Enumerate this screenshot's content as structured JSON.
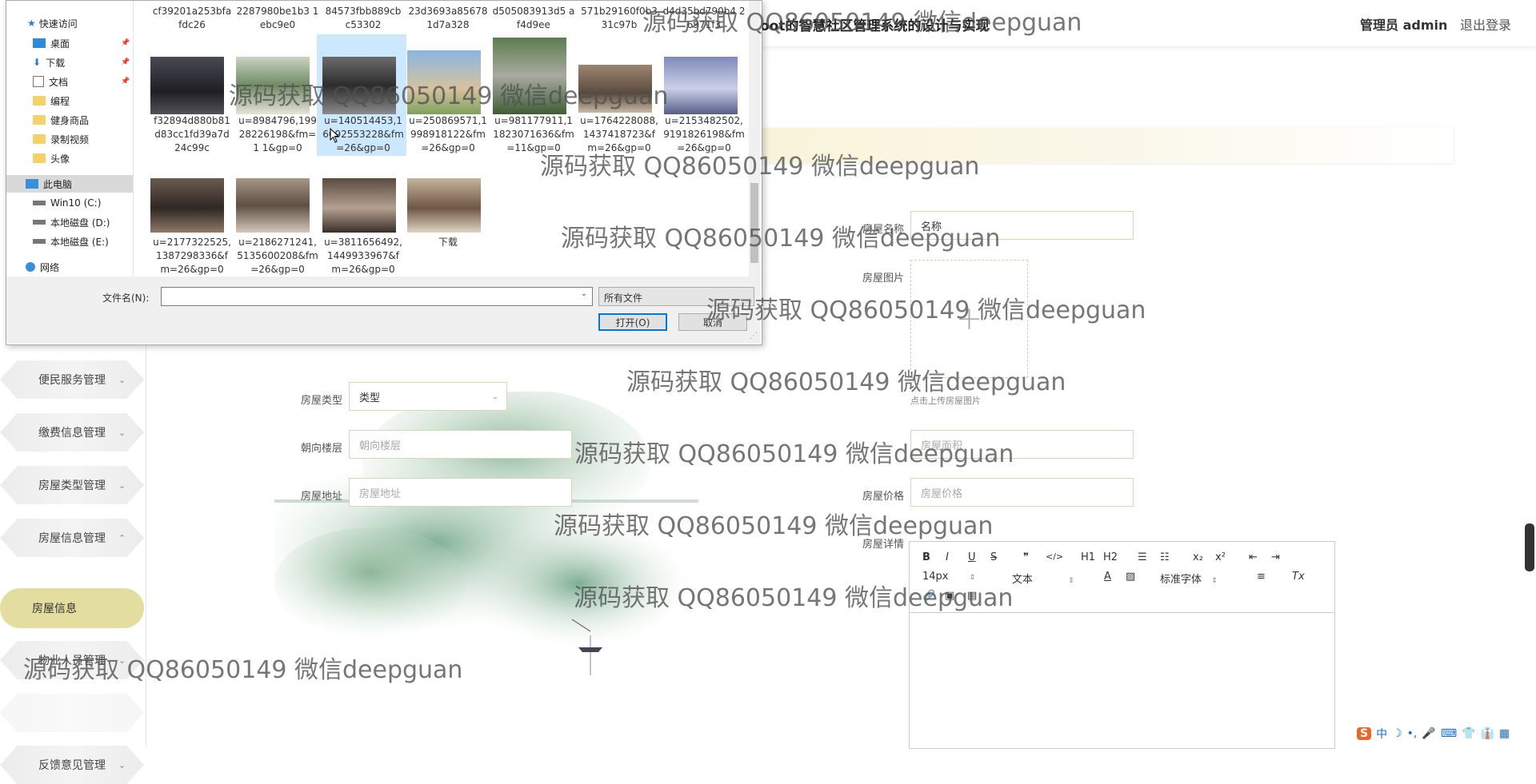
{
  "header": {
    "title": "oot的智慧社区管理系统的设计与实现",
    "admin": "管理员 admin",
    "logout": "退出登录"
  },
  "sidebar": {
    "items": [
      {
        "label": "便民服务管理"
      },
      {
        "label": "缴费信息管理"
      },
      {
        "label": "房屋类型管理"
      },
      {
        "label": "房屋信息管理"
      },
      {
        "label": "房屋信息"
      },
      {
        "label": "物业人员管理"
      },
      {
        "label": "反馈意见管理"
      }
    ],
    "chev_down": "⌄",
    "chev_up": "⌃"
  },
  "form": {
    "name_label": "房屋名称",
    "name_value": "名称",
    "image_label": "房屋图片",
    "upload_plus": "+",
    "upload_hint": "点击上传房屋图片",
    "type_label": "房屋类型",
    "type_value": "类型",
    "floor_label": "朝向楼层",
    "floor_placeholder": "朝向楼层",
    "address_label": "房屋地址",
    "address_placeholder": "房屋地址",
    "area_placeholder": "房屋面积",
    "price_label": "房屋价格",
    "price_placeholder": "房屋价格",
    "detail_label": "房屋详情"
  },
  "editor": {
    "bold": "B",
    "italic": "I",
    "underline": "U",
    "strike": "S",
    "quote": "❞",
    "code": "</>",
    "h1": "H1",
    "h2": "H2",
    "sub": "x₂",
    "sup": "x²",
    "clear": "Tx",
    "size": "14px",
    "text": "文本",
    "font": "标准字体",
    "color": "A"
  },
  "dialog": {
    "nav": [
      {
        "label": "快速访问"
      },
      {
        "label": "桌面"
      },
      {
        "label": "下载"
      },
      {
        "label": "文档"
      },
      {
        "label": "编程"
      },
      {
        "label": "健身商品"
      },
      {
        "label": "录制视频"
      },
      {
        "label": "头像"
      },
      {
        "label": "此电脑"
      },
      {
        "label": "Win10 (C:)"
      },
      {
        "label": "本地磁盘 (D:)"
      },
      {
        "label": "本地磁盘 (E:)"
      },
      {
        "label": "网络"
      }
    ],
    "pin": "📌",
    "top_captions": [
      "cf39201a253bfa fdc26",
      "2287980be1b3 1ebc9e0",
      "84573fbb889cb c53302",
      "23d3693a85678 1d7a328",
      "d505083913d5 af4d9ee",
      "571b29160f0b3 31c97b",
      "d4d35bd790b4 26971f3"
    ],
    "row1": [
      {
        "caption": "f32894d880b81 d83cc1fd39a7d 24c99c"
      },
      {
        "caption": "u=8984796,199 28226198&fm=1 1&gp=0"
      },
      {
        "caption": "u=140514453,1 6092553228&fm =26&gp=0"
      },
      {
        "caption": "u=250869571,1 998918122&fm =26&gp=0"
      },
      {
        "caption": "u=981177911,1 1823071636&fm =11&gp=0"
      },
      {
        "caption": "u=1764228088, 1437418723&f m=26&gp=0"
      },
      {
        "caption": "u=2153482502, 9191826198&fm =26&gp=0"
      }
    ],
    "row2": [
      {
        "caption": "u=2177322525, 1387298336&f m=26&gp=0"
      },
      {
        "caption": "u=2186271241, 5135600208&fm =26&gp=0"
      },
      {
        "caption": "u=3811656492, 1449933967&f m=26&gp=0"
      },
      {
        "caption": "下载"
      }
    ],
    "filename_label": "文件名(N):",
    "filename_value": "",
    "filter": "所有文件",
    "open": "打开(O)",
    "cancel": "取消"
  },
  "watermark": "源码获取 QQ86050149 微信deepguan",
  "ime": [
    "S",
    "中",
    "♪",
    "☽",
    "•,",
    "🎤",
    "⌨",
    "👕",
    "👔",
    "▦"
  ]
}
